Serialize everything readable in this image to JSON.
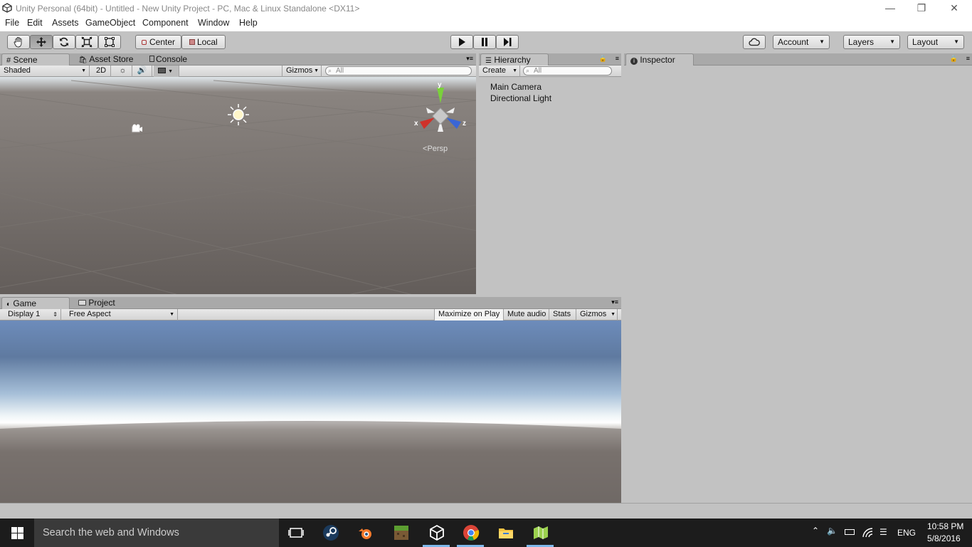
{
  "window": {
    "title": "Unity Personal (64bit) - Untitled - New Unity Project - PC, Mac & Linux Standalone <DX11>",
    "minimize_glyph": "—",
    "restore_glyph": "❐",
    "close_glyph": "✕"
  },
  "menu": [
    "File",
    "Edit",
    "Assets",
    "GameObject",
    "Component",
    "Window",
    "Help"
  ],
  "toolbar": {
    "tools": [
      "hand-icon",
      "move-icon",
      "rotate-icon",
      "scale-icon",
      "rect-icon"
    ],
    "pivot": "Center",
    "space": "Local",
    "account": "Account",
    "layers": "Layers",
    "layout": "Layout"
  },
  "scene_panel": {
    "tabs": [
      "Scene",
      "Asset Store",
      "Console"
    ],
    "shading": "Shaded",
    "mode_2d": "2D",
    "gizmos": "Gizmos",
    "search_placeholder": "All",
    "persp": "Persp",
    "axis_x": "x",
    "axis_y": "y",
    "axis_z": "z"
  },
  "hierarchy": {
    "tab": "Hierarchy",
    "create": "Create",
    "search_placeholder": "All",
    "items": [
      "Main Camera",
      "Directional Light"
    ]
  },
  "inspector": {
    "tab": "Inspector"
  },
  "game_panel": {
    "tabs": [
      "Game",
      "Project"
    ],
    "display": "Display 1",
    "aspect": "Free Aspect",
    "maximize": "Maximize on Play",
    "mute": "Mute audio",
    "stats": "Stats",
    "gizmos": "Gizmos"
  },
  "taskbar": {
    "search": "Search the web and Windows",
    "lang": "ENG",
    "time": "10:58 PM",
    "date": "5/8/2016"
  },
  "colors": {
    "editor_bg": "#c2c2c2",
    "scene_ground": "#6a6461",
    "sky": "#6d8cbb",
    "taskbar": "#1c1c1c"
  }
}
